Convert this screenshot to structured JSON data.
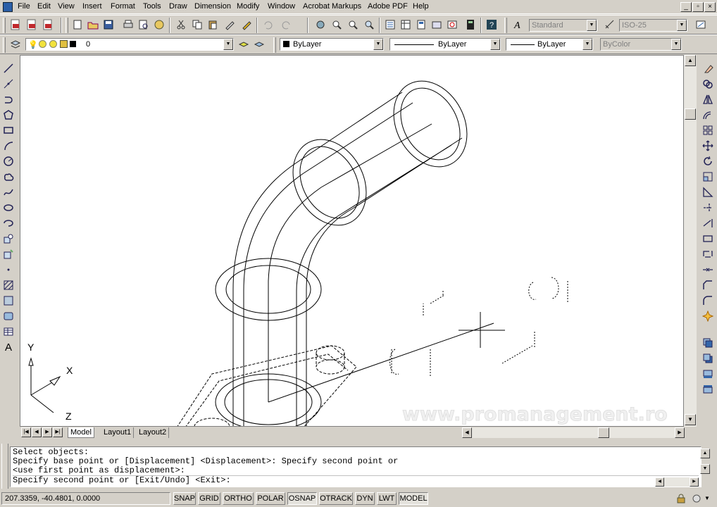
{
  "menu": [
    "File",
    "Edit",
    "View",
    "Insert",
    "Format",
    "Tools",
    "Draw",
    "Dimension",
    "Modify",
    "Window",
    "Acrobat Markups",
    "Adobe PDF",
    "Help"
  ],
  "styles": {
    "text_style": "Standard",
    "dim_style": "ISO-25"
  },
  "layers": {
    "current_layer": "0",
    "color": "ByLayer",
    "linetype": "ByLayer",
    "lineweight": "ByLayer",
    "plot_style": "ByColor"
  },
  "tabs": [
    "Model",
    "Layout1",
    "Layout2"
  ],
  "command_lines": [
    "Select objects:",
    "Specify base point or [Displacement] <Displacement>: Specify second point or",
    "<use first point as displacement>:",
    "Specify second point or [Exit/Undo] <Exit>:"
  ],
  "status": {
    "coords": "207.3359, -40.4801, 0.0000",
    "toggles": [
      "SNAP",
      "GRID",
      "ORTHO",
      "POLAR",
      "OSNAP",
      "OTRACK",
      "DYN",
      "LWT",
      "MODEL"
    ],
    "active": [
      "OSNAP",
      "MODEL"
    ]
  },
  "canvas": {
    "watermark": "www.promanagement.ro",
    "ucs": {
      "x": "X",
      "y": "Y",
      "z": "Z"
    }
  },
  "colors": {
    "ui_face": "#d4d0c8",
    "canvas": "#ffffff",
    "accent_pdf": "#c0282d"
  }
}
